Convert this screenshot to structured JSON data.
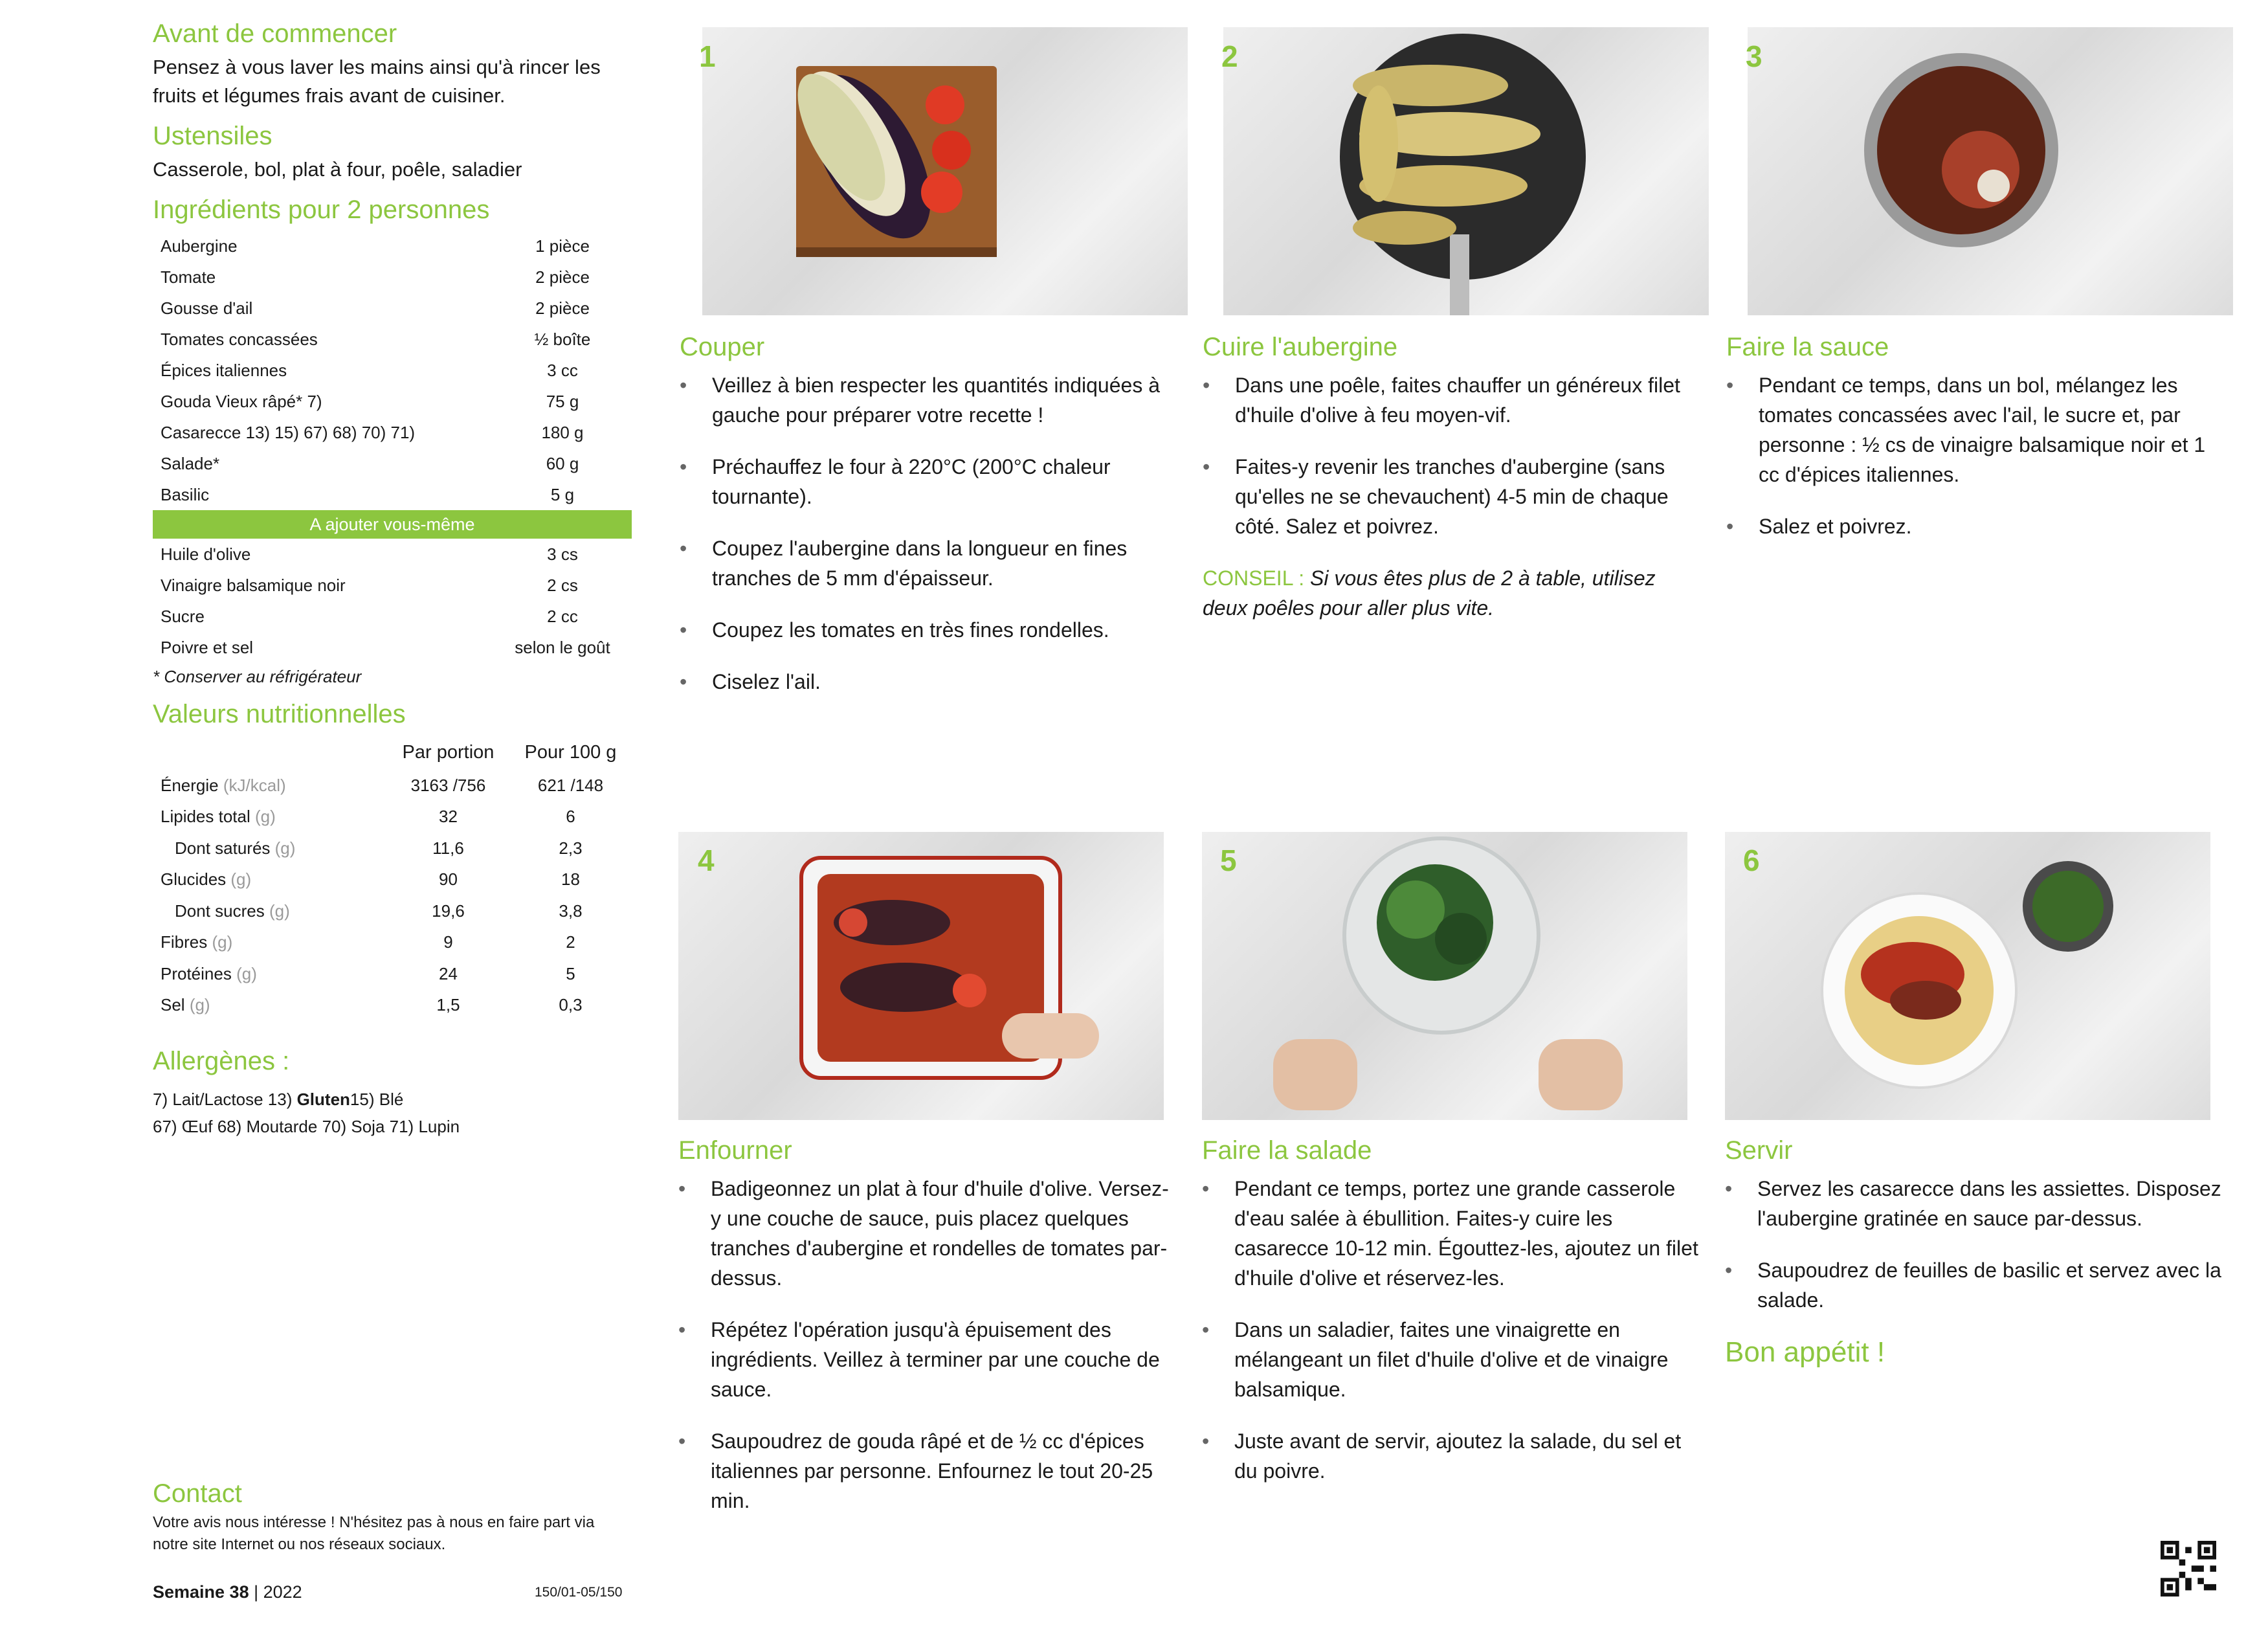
{
  "left": {
    "before_title": "Avant de commencer",
    "before_text": "Pensez à vous laver les mains ainsi qu'à rincer les fruits et légumes frais avant de cuisiner.",
    "tools_title": "Ustensiles",
    "tools_text": "Casserole, bol, plat à four, poêle, saladier",
    "ingredients_title": "Ingrédients pour 2 personnes",
    "ingredients": [
      {
        "name": "Aubergine",
        "qty": "1 pièce"
      },
      {
        "name": "Tomate",
        "qty": "2 pièce"
      },
      {
        "name": "Gousse d'ail",
        "qty": "2 pièce"
      },
      {
        "name": "Tomates concassées",
        "qty": "½ boîte"
      },
      {
        "name": "Épices italiennes",
        "qty": "3 cc"
      },
      {
        "name": "Gouda Vieux râpé* 7)",
        "qty": "75 g"
      },
      {
        "name": "Casarecce 13) 15) 67) 68) 70) 71)",
        "qty": "180 g"
      },
      {
        "name": "Salade*",
        "qty": "60 g"
      },
      {
        "name": "Basilic",
        "qty": "5 g"
      }
    ],
    "add_yourself_label": "A ajouter vous-même",
    "extra_ingredients": [
      {
        "name": "Huile d'olive",
        "qty": "3 cs"
      },
      {
        "name": "Vinaigre balsamique noir",
        "qty": "2 cs"
      },
      {
        "name": "Sucre",
        "qty": "2 cc"
      },
      {
        "name": "Poivre et sel",
        "qty": "selon le goût"
      }
    ],
    "fridge_note": "* Conserver au réfrigérateur",
    "nutrition_title": "Valeurs nutritionnelles",
    "nutrition_headers": [
      "Par portion",
      "Pour 100 g"
    ],
    "nutrition": [
      {
        "name": "Énergie",
        "unit": "(kJ/kcal)",
        "portion": "3163 /756",
        "per100": "621 /148",
        "sub": false
      },
      {
        "name": "Lipides total",
        "unit": "(g)",
        "portion": "32",
        "per100": "6",
        "sub": false
      },
      {
        "name": "Dont saturés",
        "unit": "(g)",
        "portion": "11,6",
        "per100": "2,3",
        "sub": true
      },
      {
        "name": "Glucides",
        "unit": "(g)",
        "portion": "90",
        "per100": "18",
        "sub": false
      },
      {
        "name": "Dont sucres",
        "unit": "(g)",
        "portion": "19,6",
        "per100": "3,8",
        "sub": true
      },
      {
        "name": "Fibres",
        "unit": "(g)",
        "portion": "9",
        "per100": "2",
        "sub": false
      },
      {
        "name": "Protéines",
        "unit": "(g)",
        "portion": "24",
        "per100": "5",
        "sub": false
      },
      {
        "name": "Sel",
        "unit": "(g)",
        "portion": "1,5",
        "per100": "0,3",
        "sub": false
      }
    ],
    "allergens_title": "Allergènes :",
    "allergens_line1_pre": "7) Lait/Lactose 13) ",
    "allergens_line1_bold": "Gluten",
    "allergens_line1_post": "15) Blé",
    "allergens_line2": "67) Œuf 68) Moutarde 70) Soja 71) Lupin"
  },
  "contact": {
    "title": "Contact",
    "text": "Votre avis nous intéresse ! N'hésitez pas à nous en faire part via notre site Internet ou nos réseaux sociaux."
  },
  "footer": {
    "week_bold": "Semaine 38",
    "year": "| 2022",
    "code": "150/01-05/150"
  },
  "steps": [
    {
      "num": "1",
      "title": "Couper",
      "bullets": [
        "Veillez à bien respecter les quantités indiquées à gauche pour préparer votre recette !",
        "Préchauffez le four à 220°C (200°C chaleur tournante).",
        "Coupez l'aubergine dans la longueur en fines tranches de 5 mm d'épaisseur.",
        "Coupez les tomates en très fines rondelles.",
        "Ciselez l'ail."
      ]
    },
    {
      "num": "2",
      "title": "Cuire l'aubergine",
      "bullets": [
        "Dans une poêle, faites chauffer un généreux filet d'huile d'olive à feu moyen-vif.",
        "Faites-y revenir les tranches d'aubergine (sans qu'elles ne se chevauchent) 4-5 min de chaque côté. Salez et poivrez."
      ],
      "tip_label": "CONSEIL :",
      "tip_text": "Si vous êtes plus de 2 à table, utilisez deux poêles pour aller plus vite."
    },
    {
      "num": "3",
      "title": "Faire la sauce",
      "bullets": [
        "Pendant ce temps, dans un bol, mélangez les tomates concassées avec l'ail, le sucre et, par personne : ½ cs de vinaigre balsamique noir et 1 cc d'épices italiennes.",
        "Salez et poivrez."
      ]
    },
    {
      "num": "4",
      "title": "Enfourner",
      "bullets": [
        "Badigeonnez un plat à four d'huile d'olive. Versez-y une couche de sauce, puis placez quelques tranches d'aubergine et rondelles de tomates par-dessus.",
        "Répétez l'opération jusqu'à épuisement des ingrédients. Veillez à terminer par une couche de sauce.",
        "Saupoudrez de gouda râpé et de ½ cc d'épices italiennes par personne. Enfournez le tout 20-25 min."
      ]
    },
    {
      "num": "5",
      "title": "Faire la salade",
      "bullets": [
        "Pendant ce temps, portez une grande casserole d'eau salée à ébullition. Faites-y cuire les casarecce 10-12 min. Égouttez-les, ajoutez un filet d'huile d'olive et réservez-les.",
        "Dans un saladier, faites une vinaigrette en mélangeant un filet d'huile d'olive et de vinaigre balsamique.",
        "Juste avant de servir, ajoutez la salade, du sel et du poivre."
      ]
    },
    {
      "num": "6",
      "title": "Servir",
      "bullets": [
        "Servez les casarecce dans les assiettes. Disposez l'aubergine gratinée en sauce par-dessus.",
        "Saupoudrez de feuilles de basilic et servez avec la salade."
      ],
      "closing": "Bon appétit !"
    }
  ],
  "colors": {
    "accent": "#8cc63f"
  }
}
